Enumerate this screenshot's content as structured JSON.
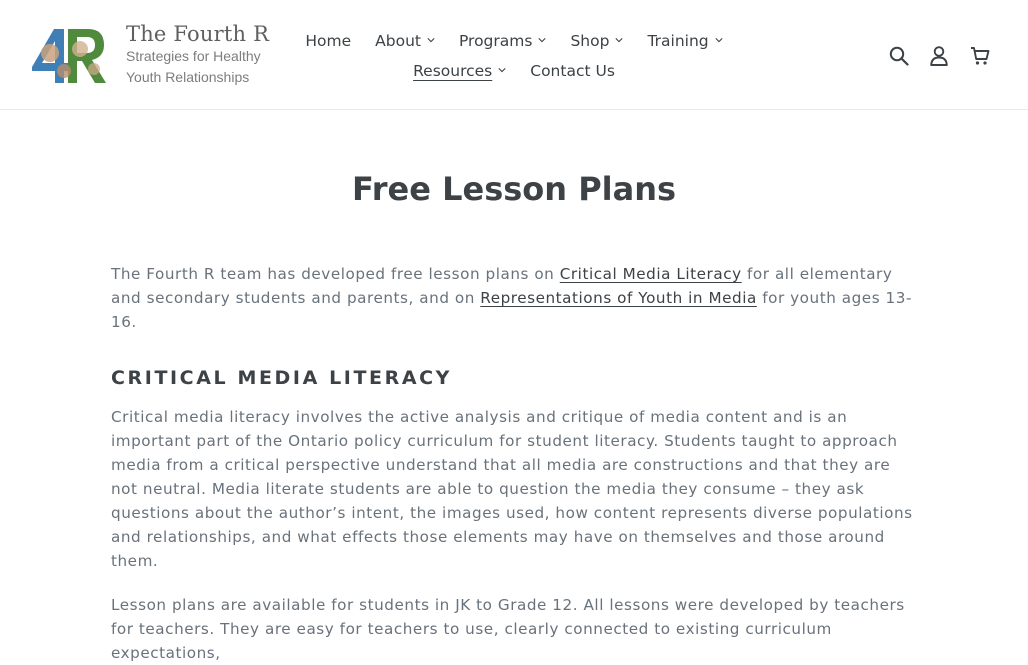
{
  "logo": {
    "title": "The Fourth R",
    "subtitle_line1": "Strategies for Healthy",
    "subtitle_line2": "Youth Relationships"
  },
  "nav": {
    "row1": [
      {
        "label": "Home",
        "dropdown": false
      },
      {
        "label": "About",
        "dropdown": true
      },
      {
        "label": "Programs",
        "dropdown": true
      },
      {
        "label": "Shop",
        "dropdown": true
      },
      {
        "label": "Training",
        "dropdown": true
      }
    ],
    "row2": [
      {
        "label": "Resources",
        "dropdown": true,
        "active": true
      },
      {
        "label": "Contact Us",
        "dropdown": false
      }
    ]
  },
  "header_icons": {
    "search": "search-icon",
    "account": "user-icon",
    "cart": "cart-icon"
  },
  "page": {
    "title": "Free Lesson Plans",
    "intro": {
      "part1": "The Fourth R team has developed free lesson plans on ",
      "link1": "Critical Media Literacy",
      "part2": " for all elementary and secondary students and parents, and on ",
      "link2": "Representations of Youth in Media",
      "part3": " for youth ages 13-16."
    },
    "section_heading": "CRITICAL MEDIA LITERACY",
    "para2": "Critical media literacy involves the active analysis and critique of media content and is an important part of the Ontario policy curriculum for student literacy. Students taught to approach media from a critical perspective understand that all media are constructions and that they are not neutral. Media literate students are able to question the media they consume – they ask questions about the author’s intent, the images used, how content represents diverse populations and relationships, and what effects those elements may have on themselves and those around them.",
    "para3": "Lesson plans are available for students in JK to Grade 12. All lessons were developed by teachers for teachers. They are easy for teachers to use, clearly connected to existing curriculum expectations,"
  },
  "colors": {
    "text_dark": "#3d4246",
    "text_body": "#69727b",
    "border": "#e8e9eb"
  }
}
